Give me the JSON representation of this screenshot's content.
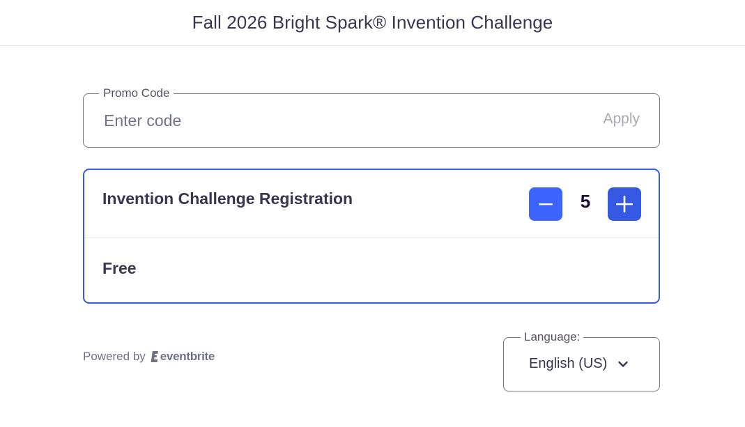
{
  "header": {
    "title": "Fall 2026 Bright Spark® Invention Challenge"
  },
  "promo": {
    "label": "Promo Code",
    "placeholder": "Enter code",
    "value": "",
    "apply_label": "Apply"
  },
  "ticket": {
    "name": "Invention Challenge Registration",
    "quantity": "5",
    "price": "Free",
    "decrement_icon": "minus-icon",
    "increment_icon": "plus-icon"
  },
  "footer": {
    "powered_by": "Powered by",
    "brand": "eventbrite",
    "language_label": "Language:",
    "language_value": "English (US)"
  },
  "colors": {
    "accent": "#3659e3",
    "accent_light": "#3d64ff",
    "text": "#39364f",
    "muted": "#6f7287",
    "border": "#7a7785"
  }
}
